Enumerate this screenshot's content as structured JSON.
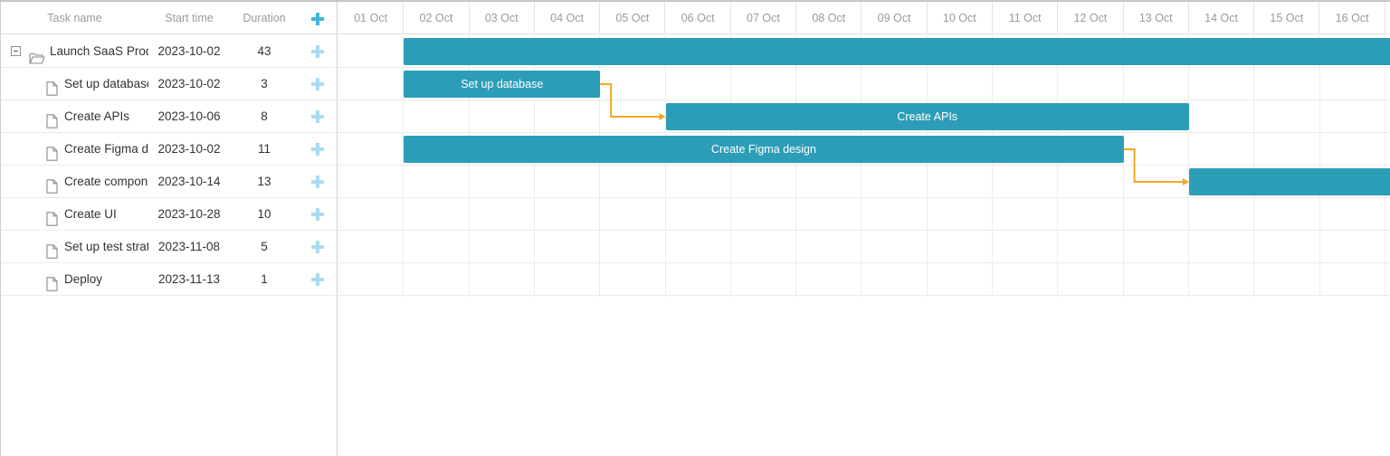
{
  "grid": {
    "columns": {
      "task_name": "Task name",
      "start_time": "Start time",
      "duration": "Duration"
    },
    "add_icon": "plus-icon",
    "tasks": [
      {
        "name": "Launch SaaS Product",
        "start": "2023-10-02",
        "duration": "43",
        "type": "project",
        "icon": "folder-open-icon",
        "expanded": true
      },
      {
        "name": "Set up database",
        "start": "2023-10-02",
        "duration": "3",
        "type": "task",
        "icon": "file-icon"
      },
      {
        "name": "Create APIs",
        "start": "2023-10-06",
        "duration": "8",
        "type": "task",
        "icon": "file-icon"
      },
      {
        "name": "Create Figma design",
        "start": "2023-10-02",
        "duration": "11",
        "type": "task",
        "icon": "file-icon"
      },
      {
        "name": "Create components",
        "start": "2023-10-14",
        "duration": "13",
        "type": "task",
        "icon": "file-icon"
      },
      {
        "name": "Create UI",
        "start": "2023-10-28",
        "duration": "10",
        "type": "task",
        "icon": "file-icon"
      },
      {
        "name": "Set up test strategy",
        "start": "2023-11-08",
        "duration": "5",
        "type": "task",
        "icon": "file-icon"
      },
      {
        "name": "Deploy",
        "start": "2023-11-13",
        "duration": "1",
        "type": "task",
        "icon": "file-icon"
      }
    ]
  },
  "timeline": {
    "scale": [
      "01 Oct",
      "02 Oct",
      "03 Oct",
      "04 Oct",
      "05 Oct",
      "06 Oct",
      "07 Oct",
      "08 Oct",
      "09 Oct",
      "10 Oct",
      "11 Oct",
      "12 Oct",
      "13 Oct",
      "14 Oct",
      "15 Oct",
      "16 Oct"
    ],
    "bars": [
      {
        "row": 0,
        "label": ""
      },
      {
        "row": 1,
        "label": "Set up database"
      },
      {
        "row": 2,
        "label": "Create APIs"
      },
      {
        "row": 3,
        "label": "Create Figma design"
      },
      {
        "row": 4,
        "label": ""
      }
    ],
    "links": [
      {
        "from": 1,
        "to": 2
      },
      {
        "from": 3,
        "to": 4
      }
    ]
  },
  "colors": {
    "bar": "#2c9db7",
    "link": "#f5a623",
    "add_icon": "#a9dcee",
    "add_icon_header": "#3fb4e0"
  }
}
